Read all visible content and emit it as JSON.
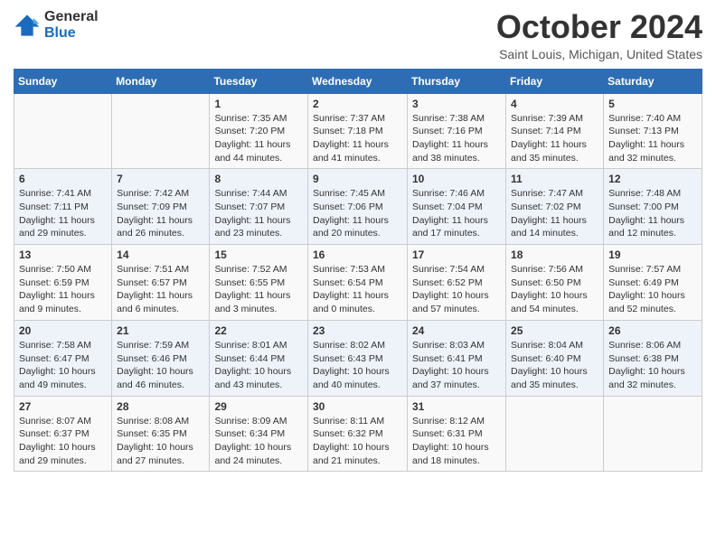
{
  "header": {
    "logo": {
      "general": "General",
      "blue": "Blue"
    },
    "title": "October 2024",
    "location": "Saint Louis, Michigan, United States"
  },
  "calendar": {
    "days_of_week": [
      "Sunday",
      "Monday",
      "Tuesday",
      "Wednesday",
      "Thursday",
      "Friday",
      "Saturday"
    ],
    "weeks": [
      [
        {
          "day": "",
          "sunrise": "",
          "sunset": "",
          "daylight": ""
        },
        {
          "day": "",
          "sunrise": "",
          "sunset": "",
          "daylight": ""
        },
        {
          "day": "1",
          "sunrise": "Sunrise: 7:35 AM",
          "sunset": "Sunset: 7:20 PM",
          "daylight": "Daylight: 11 hours and 44 minutes."
        },
        {
          "day": "2",
          "sunrise": "Sunrise: 7:37 AM",
          "sunset": "Sunset: 7:18 PM",
          "daylight": "Daylight: 11 hours and 41 minutes."
        },
        {
          "day": "3",
          "sunrise": "Sunrise: 7:38 AM",
          "sunset": "Sunset: 7:16 PM",
          "daylight": "Daylight: 11 hours and 38 minutes."
        },
        {
          "day": "4",
          "sunrise": "Sunrise: 7:39 AM",
          "sunset": "Sunset: 7:14 PM",
          "daylight": "Daylight: 11 hours and 35 minutes."
        },
        {
          "day": "5",
          "sunrise": "Sunrise: 7:40 AM",
          "sunset": "Sunset: 7:13 PM",
          "daylight": "Daylight: 11 hours and 32 minutes."
        }
      ],
      [
        {
          "day": "6",
          "sunrise": "Sunrise: 7:41 AM",
          "sunset": "Sunset: 7:11 PM",
          "daylight": "Daylight: 11 hours and 29 minutes."
        },
        {
          "day": "7",
          "sunrise": "Sunrise: 7:42 AM",
          "sunset": "Sunset: 7:09 PM",
          "daylight": "Daylight: 11 hours and 26 minutes."
        },
        {
          "day": "8",
          "sunrise": "Sunrise: 7:44 AM",
          "sunset": "Sunset: 7:07 PM",
          "daylight": "Daylight: 11 hours and 23 minutes."
        },
        {
          "day": "9",
          "sunrise": "Sunrise: 7:45 AM",
          "sunset": "Sunset: 7:06 PM",
          "daylight": "Daylight: 11 hours and 20 minutes."
        },
        {
          "day": "10",
          "sunrise": "Sunrise: 7:46 AM",
          "sunset": "Sunset: 7:04 PM",
          "daylight": "Daylight: 11 hours and 17 minutes."
        },
        {
          "day": "11",
          "sunrise": "Sunrise: 7:47 AM",
          "sunset": "Sunset: 7:02 PM",
          "daylight": "Daylight: 11 hours and 14 minutes."
        },
        {
          "day": "12",
          "sunrise": "Sunrise: 7:48 AM",
          "sunset": "Sunset: 7:00 PM",
          "daylight": "Daylight: 11 hours and 12 minutes."
        }
      ],
      [
        {
          "day": "13",
          "sunrise": "Sunrise: 7:50 AM",
          "sunset": "Sunset: 6:59 PM",
          "daylight": "Daylight: 11 hours and 9 minutes."
        },
        {
          "day": "14",
          "sunrise": "Sunrise: 7:51 AM",
          "sunset": "Sunset: 6:57 PM",
          "daylight": "Daylight: 11 hours and 6 minutes."
        },
        {
          "day": "15",
          "sunrise": "Sunrise: 7:52 AM",
          "sunset": "Sunset: 6:55 PM",
          "daylight": "Daylight: 11 hours and 3 minutes."
        },
        {
          "day": "16",
          "sunrise": "Sunrise: 7:53 AM",
          "sunset": "Sunset: 6:54 PM",
          "daylight": "Daylight: 11 hours and 0 minutes."
        },
        {
          "day": "17",
          "sunrise": "Sunrise: 7:54 AM",
          "sunset": "Sunset: 6:52 PM",
          "daylight": "Daylight: 10 hours and 57 minutes."
        },
        {
          "day": "18",
          "sunrise": "Sunrise: 7:56 AM",
          "sunset": "Sunset: 6:50 PM",
          "daylight": "Daylight: 10 hours and 54 minutes."
        },
        {
          "day": "19",
          "sunrise": "Sunrise: 7:57 AM",
          "sunset": "Sunset: 6:49 PM",
          "daylight": "Daylight: 10 hours and 52 minutes."
        }
      ],
      [
        {
          "day": "20",
          "sunrise": "Sunrise: 7:58 AM",
          "sunset": "Sunset: 6:47 PM",
          "daylight": "Daylight: 10 hours and 49 minutes."
        },
        {
          "day": "21",
          "sunrise": "Sunrise: 7:59 AM",
          "sunset": "Sunset: 6:46 PM",
          "daylight": "Daylight: 10 hours and 46 minutes."
        },
        {
          "day": "22",
          "sunrise": "Sunrise: 8:01 AM",
          "sunset": "Sunset: 6:44 PM",
          "daylight": "Daylight: 10 hours and 43 minutes."
        },
        {
          "day": "23",
          "sunrise": "Sunrise: 8:02 AM",
          "sunset": "Sunset: 6:43 PM",
          "daylight": "Daylight: 10 hours and 40 minutes."
        },
        {
          "day": "24",
          "sunrise": "Sunrise: 8:03 AM",
          "sunset": "Sunset: 6:41 PM",
          "daylight": "Daylight: 10 hours and 37 minutes."
        },
        {
          "day": "25",
          "sunrise": "Sunrise: 8:04 AM",
          "sunset": "Sunset: 6:40 PM",
          "daylight": "Daylight: 10 hours and 35 minutes."
        },
        {
          "day": "26",
          "sunrise": "Sunrise: 8:06 AM",
          "sunset": "Sunset: 6:38 PM",
          "daylight": "Daylight: 10 hours and 32 minutes."
        }
      ],
      [
        {
          "day": "27",
          "sunrise": "Sunrise: 8:07 AM",
          "sunset": "Sunset: 6:37 PM",
          "daylight": "Daylight: 10 hours and 29 minutes."
        },
        {
          "day": "28",
          "sunrise": "Sunrise: 8:08 AM",
          "sunset": "Sunset: 6:35 PM",
          "daylight": "Daylight: 10 hours and 27 minutes."
        },
        {
          "day": "29",
          "sunrise": "Sunrise: 8:09 AM",
          "sunset": "Sunset: 6:34 PM",
          "daylight": "Daylight: 10 hours and 24 minutes."
        },
        {
          "day": "30",
          "sunrise": "Sunrise: 8:11 AM",
          "sunset": "Sunset: 6:32 PM",
          "daylight": "Daylight: 10 hours and 21 minutes."
        },
        {
          "day": "31",
          "sunrise": "Sunrise: 8:12 AM",
          "sunset": "Sunset: 6:31 PM",
          "daylight": "Daylight: 10 hours and 18 minutes."
        },
        {
          "day": "",
          "sunrise": "",
          "sunset": "",
          "daylight": ""
        },
        {
          "day": "",
          "sunrise": "",
          "sunset": "",
          "daylight": ""
        }
      ]
    ]
  }
}
